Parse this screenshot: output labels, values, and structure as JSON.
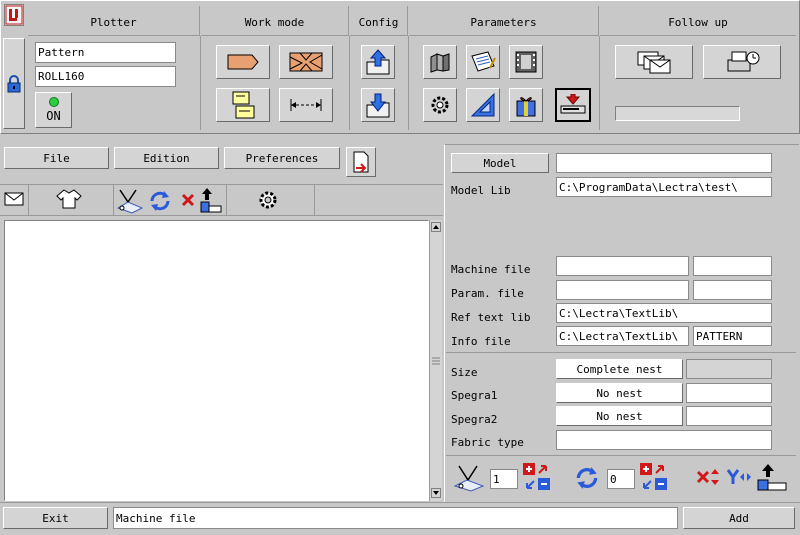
{
  "header": {
    "groups": {
      "plotter": "Plotter",
      "work_mode": "Work mode",
      "config": "Config",
      "parameters": "Parameters",
      "follow_up": "Follow up"
    },
    "pattern_value": "Pattern",
    "roll_value": "ROLL160",
    "on_label": "ON"
  },
  "menu": {
    "file": "File",
    "edition": "Edition",
    "preferences": "Preferences"
  },
  "right_panel": {
    "model_button": "Model",
    "model_value": "",
    "model_lib_label": "Model Lib",
    "model_lib_value": "C:\\ProgramData\\Lectra\\test\\",
    "machine_file_label": "Machine file",
    "param_file_label": "Param. file",
    "ref_text_lib_label": "Ref text lib",
    "ref_text_lib_value": "C:\\Lectra\\TextLib\\",
    "info_file_label": "Info file",
    "info_file_value": "C:\\Lectra\\TextLib\\",
    "info_file_name": "PATTERN",
    "size_label": "Size",
    "size_button": "Complete nest",
    "spegra1_label": "Spegra1",
    "spegra1_button": "No nest",
    "spegra2_label": "Spegra2",
    "spegra2_button": "No nest",
    "fabric_type_label": "Fabric type",
    "counter1": "1",
    "counter2": "0"
  },
  "footer": {
    "exit": "Exit",
    "status": "Machine file",
    "add": "Add"
  },
  "colors": {
    "background": "#c8c8c8",
    "panel": "#d4d4d4",
    "accent_red": "#d01818",
    "accent_blue": "#2a5ad8",
    "status_green": "#2ecc40"
  }
}
